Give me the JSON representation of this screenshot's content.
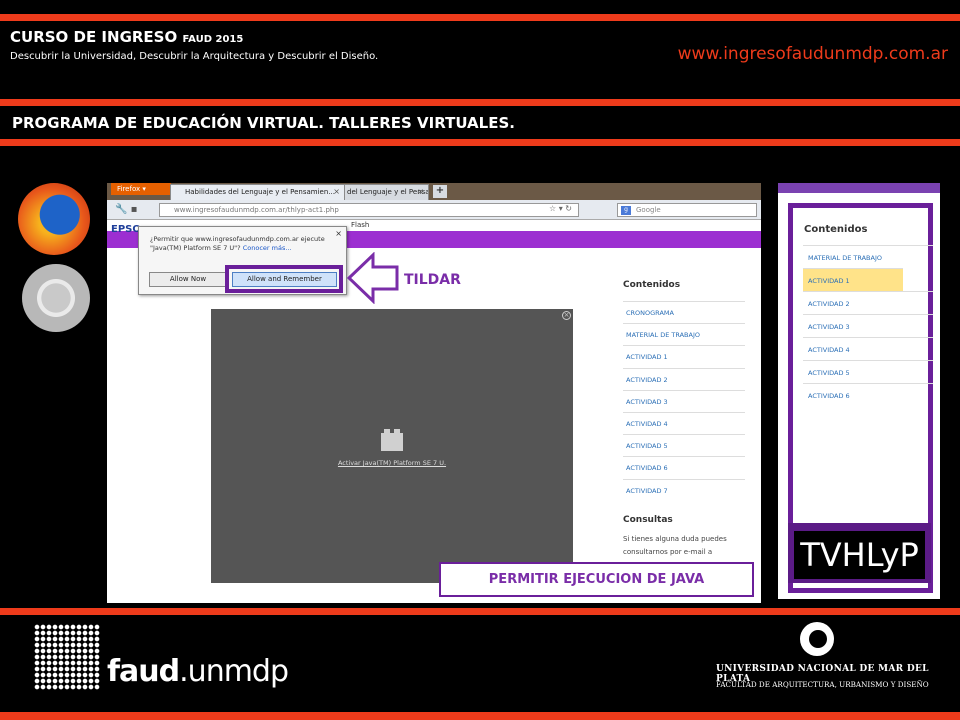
{
  "header": {
    "course_title": "CURSO DE INGRESO",
    "course_year": "FAUD 2015",
    "subtitle": "Descubrir la Universidad, Descubrir la Arquitectura y Descubrir el Diseño.",
    "url": "www.ingresofaudunmdp.com.ar",
    "program": "PROGRAMA DE EDUCACIÓN VIRTUAL. TALLERES VIRTUALES."
  },
  "colors": {
    "accent": "#ee3b1b",
    "purple": "#6a1f9a",
    "link": "#2b6fb6"
  },
  "browser": {
    "firefox_button": "Firefox ▾",
    "tab1": "Habilidades del Lenguaje y el Pensamien...",
    "tab2": "del Lenguaje y el Pensam...",
    "tab_new": "+",
    "address": "www.ingresofaudunmdp.com.ar/thlyp-act1.php",
    "search_placeholder": "Google",
    "page_left": "Flash",
    "site_logo": "EPSO"
  },
  "popup": {
    "text_1": "¿Permitir que www.ingresofaudunmdp.com.ar ejecute \"Java(TM) Platform SE 7 U\"?",
    "link": "Conocer más...",
    "allow_now": "Allow Now",
    "allow_remember": "Allow and Remember"
  },
  "plugin": {
    "activate": "Activar Java(TM) Platform SE 7 U."
  },
  "sidebar": {
    "title": "Contenidos",
    "items": [
      "CRONOGRAMA",
      "MATERIAL DE TRABAJO",
      "ACTIVIDAD 1",
      "ACTIVIDAD 2",
      "ACTIVIDAD 3",
      "ACTIVIDAD 4",
      "ACTIVIDAD 5",
      "ACTIVIDAD 6",
      "ACTIVIDAD 7"
    ],
    "consultas_title": "Consultas",
    "consultas_text": "Si tienes alguna duda puedes consultarnos por e-mail a"
  },
  "annotations": {
    "tildar": "TILDAR",
    "java": "PERMITIR EJECUCION DE  JAVA"
  },
  "right_panel": {
    "title": "Contenidos",
    "items": [
      "MATERIAL DE TRABAJO",
      "ACTIVIDAD 1",
      "ACTIVIDAD 2",
      "ACTIVIDAD 3",
      "ACTIVIDAD 4",
      "ACTIVIDAD 5",
      "ACTIVIDAD 6"
    ],
    "active": "ACTIVIDAD 1",
    "badge": "TVHLyP"
  },
  "footer": {
    "faud_bold": "faud",
    "faud_rest": ".unmdp",
    "univ_line1": "UNIVERSIDAD NACIONAL DE MAR DEL PLATA",
    "univ_line2": "FACULTAD DE ARQUITECTURA, URBANISMO Y DISEÑO"
  }
}
